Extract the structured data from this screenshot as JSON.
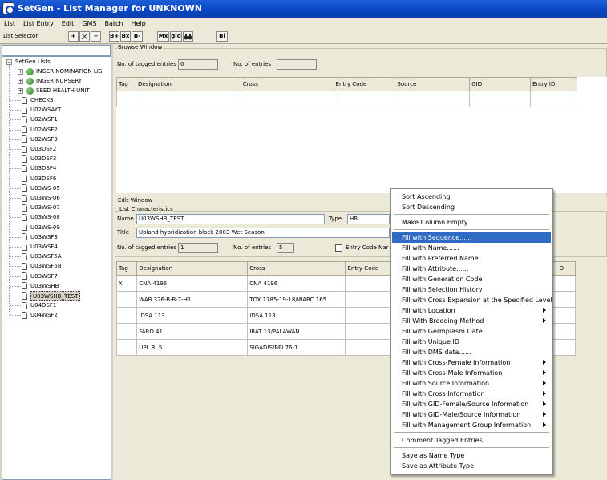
{
  "title": "SetGen - List Manager for UNKNOWN",
  "menus": [
    "List",
    "List Entry",
    "Edit",
    "GMS",
    "Batch",
    "Help"
  ],
  "toolbar": {
    "list_selector_label": "List Selector",
    "buttons": [
      "+",
      "",
      "−",
      "B+",
      "Bx",
      "B-",
      "Mx",
      "gid",
      "",
      "Bi"
    ]
  },
  "tree": {
    "root": "SetGen Lists",
    "folders": [
      "INGER NOMINATION LIS",
      "INGER NURSERY",
      "SEED HEALTH UNIT"
    ],
    "items": [
      "CHECKS",
      "U02WSAYT",
      "U02WSF1",
      "U02WSF2",
      "U02WSF3",
      "U03DSF2",
      "U03DSF3",
      "U03DSF4",
      "U03DSF6",
      "U03WS-05",
      "U03WS-06",
      "U03WS-07",
      "U03WS-08",
      "U03WS-09",
      "U03WSF3",
      "U03WSF4",
      "U03WSF5A",
      "U03WSF5B",
      "U03WSF7",
      "U03WSHB",
      "U03WSHB_TEST",
      "U04DSF1",
      "U04WSF2"
    ],
    "selected": "U03WSHB_TEST"
  },
  "browse": {
    "title": "Browse Window",
    "tagged_label": "No. of tagged entries",
    "tagged_value": "0",
    "entries_label": "No. of entries",
    "entries_value": "",
    "columns": [
      "Tag",
      "Designation",
      "Cross",
      "Entry Code",
      "Source",
      "GID",
      "Entry ID"
    ]
  },
  "edit": {
    "title": "Edit Window",
    "characteristics_title": "List Characteristics",
    "name_label": "Name",
    "name_value": "U03WSHB_TEST",
    "type_label": "Type",
    "type_value": "HB",
    "title_label": "Title",
    "title_value": "Upland hybridization block 2003 Wet Season",
    "tagged_label": "No. of tagged entries",
    "tagged_value": "1",
    "entries_label": "No. of entries",
    "entries_value": "5",
    "entry_code_label": "Entry Code Nar",
    "columns": [
      "Tag",
      "Designation",
      "Cross",
      "Entry Code",
      "D"
    ],
    "rows": [
      {
        "tag": "X",
        "designation": "CNA 4196",
        "cross": "CNA 4196"
      },
      {
        "tag": "",
        "designation": "WAB 326-B-B-7-H1",
        "cross": "TOX 1785-19-18/WABC 165"
      },
      {
        "tag": "",
        "designation": "IDSA 113",
        "cross": "IDSA 113"
      },
      {
        "tag": "",
        "designation": "FARO 41",
        "cross": "IRAT 13/PALAWAN"
      },
      {
        "tag": "",
        "designation": "UPL RI 5",
        "cross": "SIGADIS/BPI 76-1"
      }
    ]
  },
  "context_menu": {
    "groups": [
      [
        {
          "label": "Sort Ascending"
        },
        {
          "label": "Sort Descending"
        }
      ],
      [
        {
          "label": "Make Column Empty"
        }
      ],
      [
        {
          "label": "Fill with Sequence......",
          "highlighted": true
        },
        {
          "label": "Fill with Name......"
        },
        {
          "label": "Fill with Preferred Name"
        },
        {
          "label": "Fill with Attribute......"
        },
        {
          "label": "Fill with Generation Code"
        },
        {
          "label": "Fill with Selection History"
        },
        {
          "label": "Fill with Cross Expansion at the Specified Level"
        },
        {
          "label": "Fill with Location",
          "submenu": true
        },
        {
          "label": "Fill With Breeding Method",
          "submenu": true
        },
        {
          "label": "Fill with Germplasm Date"
        },
        {
          "label": "Fill with Unique ID"
        },
        {
          "label": "Fill with DMS data......"
        },
        {
          "label": "Fill with Cross-Female Information",
          "submenu": true
        },
        {
          "label": "Fill with Cross-Male Information",
          "submenu": true
        },
        {
          "label": "Fill with Source Information",
          "submenu": true
        },
        {
          "label": "Fill with Cross Information",
          "submenu": true
        },
        {
          "label": "Fill with GID-Female/Source Information",
          "submenu": true
        },
        {
          "label": "Fill with GID-Male/Source Information",
          "submenu": true
        },
        {
          "label": "Fill with Management Group Information",
          "submenu": true
        }
      ],
      [
        {
          "label": "Comment Tagged Entries"
        }
      ],
      [
        {
          "label": "Save as Name Type"
        },
        {
          "label": "Save as Attribute Type"
        }
      ]
    ]
  }
}
